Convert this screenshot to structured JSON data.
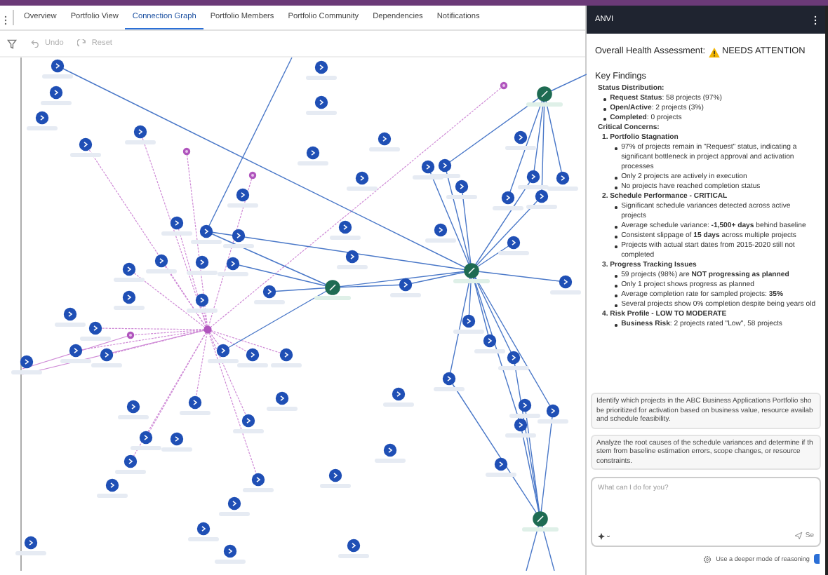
{
  "tabs": [
    {
      "label": "Overview",
      "selected": false
    },
    {
      "label": "Portfolio View",
      "selected": false
    },
    {
      "label": "Connection Graph",
      "selected": true
    },
    {
      "label": "Portfolio Members",
      "selected": false
    },
    {
      "label": "Portfolio Community",
      "selected": false
    },
    {
      "label": "Dependencies",
      "selected": false
    },
    {
      "label": "Notifications",
      "selected": false
    }
  ],
  "toolbar": [
    {
      "kind": "filter",
      "disabled": false
    },
    {
      "kind": "undo",
      "label": "Undo",
      "disabled": true
    },
    {
      "kind": "reset",
      "label": "Reset",
      "disabled": true
    }
  ],
  "assistant": {
    "title": "ANVI",
    "heading": "Overall Health Assessment:",
    "status": "NEEDS ATTENTION",
    "findings_title": "Key Findings",
    "status_distribution": {
      "label": "Status Distribution:",
      "items": [
        "**Request Status**: 58 projects (97%)",
        "**Open/Active**: 2 projects (3%)",
        "**Completed**: 0 projects"
      ]
    },
    "critical_concerns": {
      "label": "Critical Concerns:",
      "items": [
        {
          "title": "1. Portfolio Stagnation",
          "items": [
            "97% of projects remain in \"Request\" status, indicating a significant bottleneck in project approval and activation processes",
            "Only 2 projects are actively in execution",
            "No projects have reached completion status"
          ]
        },
        {
          "title": "2. Schedule Performance - CRITICAL",
          "items": [
            "Significant schedule variances detected across active projects",
            "Average schedule variance: **-1,500+ days** behind baseline",
            "Consistent slippage of **15 days** across multiple projects",
            "Projects with actual start dates from 2015-2020 still not completed"
          ]
        },
        {
          "title": "3. Progress Tracking Issues",
          "items": [
            "59 projects (98%) are **NOT progressing as planned**",
            "Only 1 project shows progress as planned",
            "Average completion rate for sampled projects: **35%**",
            "Several projects show 0% completion despite being years old"
          ]
        },
        {
          "title": "4. Risk Profile - LOW TO MODERATE",
          "items": [
            "**Business Risk**: 2 projects rated \"Low\", 58 projects"
          ]
        }
      ]
    },
    "suggestions": [
      "Identify which projects in the ABC Business Applications Portfolio sho be prioritized for activation based on business value, resource availab and schedule feasibility.",
      "Analyze the root causes of the schedule variances and determine if th stem from baseline estimation errors, scope changes, or resource constraints."
    ],
    "input": {
      "placeholder": "What can I do for you?",
      "send_label": "Se"
    },
    "reasoning_label": "Use a deeper mode of reasoning"
  }
}
